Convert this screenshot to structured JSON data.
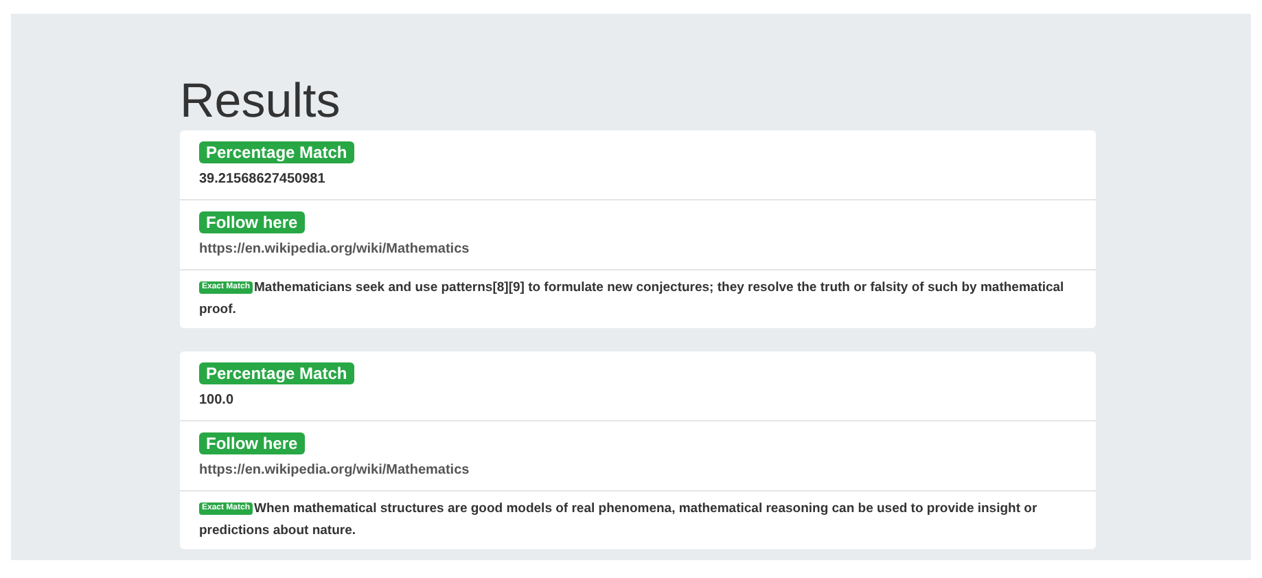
{
  "heading": "Results",
  "results": [
    {
      "percentage_label": "Percentage Match",
      "percentage": "39.21568627450981",
      "link_label": "Follow here",
      "url": "https://en.wikipedia.org/wiki/Mathematics",
      "match_badge": "Exact Match",
      "sentence": "Mathematicians seek and use patterns[8][9] to formulate new conjectures; they resolve the truth or falsity of such by mathematical proof."
    },
    {
      "percentage_label": "Percentage Match",
      "percentage": "100.0",
      "link_label": "Follow here",
      "url": "https://en.wikipedia.org/wiki/Mathematics",
      "match_badge": "Exact Match",
      "sentence": "When mathematical structures are good models of real phenomena, mathematical reasoning can be used to provide insight or predictions about nature."
    }
  ]
}
